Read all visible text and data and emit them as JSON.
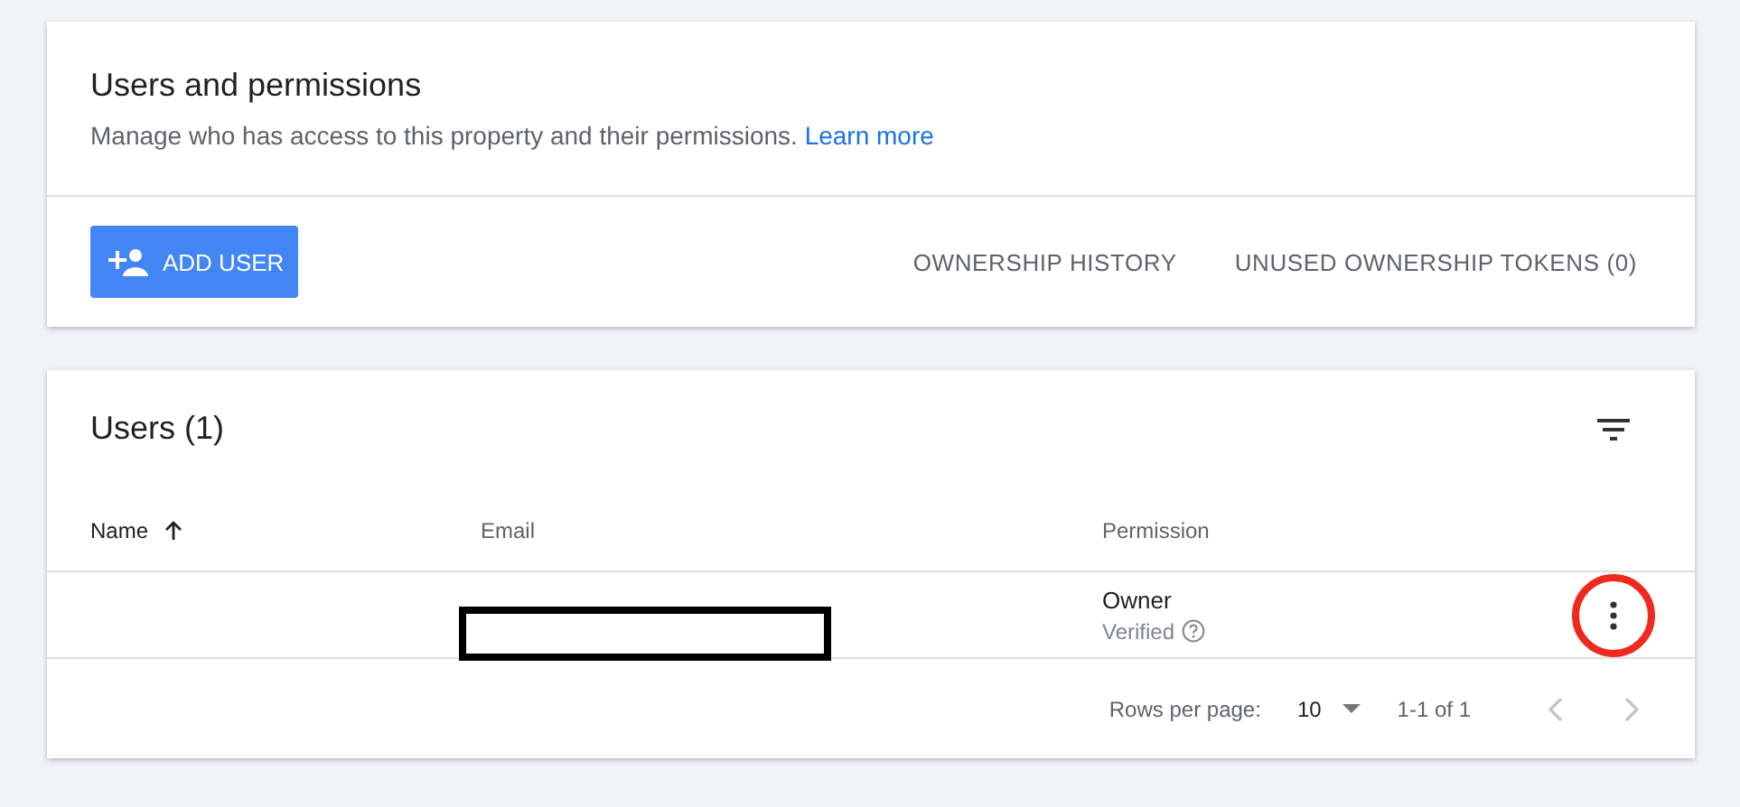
{
  "header": {
    "title": "Users and permissions",
    "description": "Manage who has access to this property and their permissions.",
    "link": "Learn more"
  },
  "actions": {
    "add_user": "ADD USER",
    "links": [
      "OWNERSHIP HISTORY",
      "UNUSED OWNERSHIP TOKENS (0)"
    ]
  },
  "users": {
    "title": "Users (1)",
    "columns": [
      {
        "label": "Name",
        "sorted": true
      },
      {
        "label": "Email",
        "sorted": false
      },
      {
        "label": "Permission",
        "sorted": false
      }
    ],
    "rows": [
      {
        "permission": "Owner",
        "status": "Verified",
        "email_redacted": true,
        "menu_highlighted": true
      }
    ],
    "footer": {
      "rows_label": "Rows per page:",
      "rows_value": "10",
      "range": "1-1 of 1",
      "prev_disabled": true,
      "next_disabled": true
    }
  }
}
